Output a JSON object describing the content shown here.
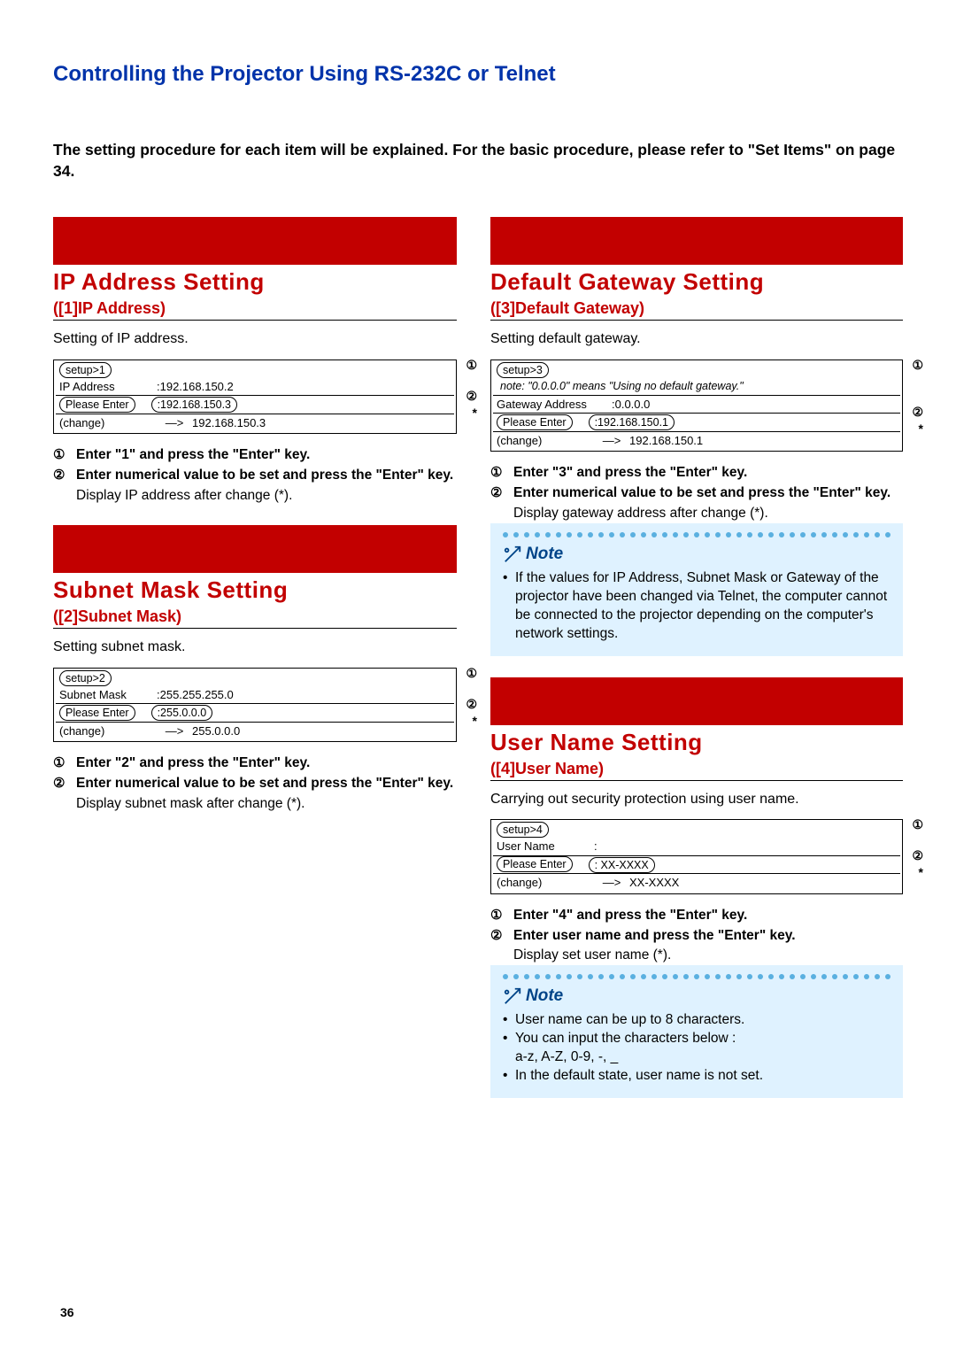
{
  "page_number": "36",
  "main_title": "Controlling the Projector Using RS-232C or Telnet",
  "intro_a": "The setting procedure for each item will be explained. For the basic procedure, please refer to \"Set Items\" on page ",
  "intro_b": "34",
  "intro_c": ".",
  "left": {
    "ip": {
      "title": "IP Address Setting",
      "sub": "([1]IP Address)",
      "body": "Setting of IP address.",
      "term": {
        "cmd": "setup>1",
        "r1a": "IP Address",
        "r1b": ":192.168.150.2",
        "r2a": "Please Enter",
        "r2b": ":192.168.150.3",
        "r3a": "(change)",
        "r3arrow": "—>",
        "r3b": "192.168.150.3"
      },
      "s1": "Enter \"1\" and press the \"Enter\" key.",
      "s2": "Enter numerical value to be set and press the \"Enter\" key.",
      "p": "Display IP address after change (*)."
    },
    "sm": {
      "title": "Subnet Mask Setting",
      "sub": "([2]Subnet Mask)",
      "body": "Setting subnet mask.",
      "term": {
        "cmd": "setup>2",
        "r1a": "Subnet Mask",
        "r1b": ":255.255.255.0",
        "r2a": "Please Enter",
        "r2b": ":255.0.0.0",
        "r3a": "(change)",
        "r3arrow": "—>",
        "r3b": "255.0.0.0"
      },
      "s1": "Enter \"2\" and press the \"Enter\" key.",
      "s2": "Enter numerical value to be set and press the \"Enter\" key.",
      "p": "Display subnet mask after change (*)."
    }
  },
  "right": {
    "gw": {
      "title": "Default Gateway Setting",
      "sub": "([3]Default Gateway)",
      "body": "Setting default gateway.",
      "term": {
        "cmd": "setup>3",
        "note": "note: \"0.0.0.0\" means \"Using no default gateway.\"",
        "r1a": "Gateway Address",
        "r1b": ":0.0.0.0",
        "r2a": "Please Enter",
        "r2b": ":192.168.150.1",
        "r3a": "(change)",
        "r3arrow": "—>",
        "r3b": "192.168.150.1"
      },
      "s1": "Enter \"3\" and press the \"Enter\" key.",
      "s2": "Enter numerical value to be set and press the \"Enter\" key.",
      "p": "Display gateway address after change (*).",
      "note_t": "Note",
      "note1": "If the values for IP Address, Subnet Mask or Gateway of the projector have been changed via Telnet, the computer cannot be connected to the projector depending on the computer's network settings."
    },
    "un": {
      "title": "User Name Setting",
      "sub": "([4]User Name)",
      "body": "Carrying out security protection using user name.",
      "term": {
        "cmd": "setup>4",
        "r1a": "User Name",
        "r1b": ":",
        "r2a": "Please Enter",
        "r2b": ": XX-XXXX",
        "r3a": "(change)",
        "r3arrow": "—>",
        "r3b": "XX-XXXX"
      },
      "s1": "Enter \"4\" and press the \"Enter\" key.",
      "s2": "Enter user name and press the \"Enter\" key.",
      "p": "Display set user name (*).",
      "note_t": "Note",
      "note1": "User name can be up to 8 characters.",
      "note2": "You can input the characters below :",
      "note2b": "a-z, A-Z, 0-9, -, _",
      "note3": "In the default state, user name is not set."
    }
  },
  "circ": {
    "1": "①",
    "2": "②",
    "star": "*"
  }
}
